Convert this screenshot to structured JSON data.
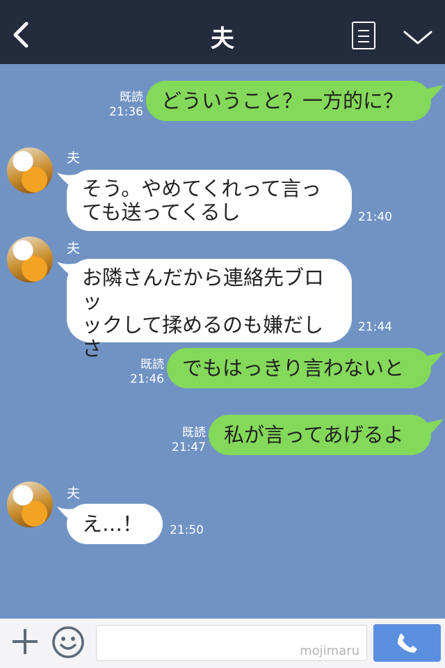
{
  "header": {
    "title": "夫"
  },
  "messages": [
    {
      "side": "right",
      "text": "どういうこと？一方的に？",
      "read": "既読",
      "time": "21:36"
    },
    {
      "side": "left",
      "sender": "夫",
      "lines": [
        "そう。やめてくれって言っ",
        "ても送ってくるし"
      ],
      "time": "21:40"
    },
    {
      "side": "left",
      "sender": "夫",
      "lines": [
        "お隣さんだから連絡先ブロッ",
        "ックして揉めるのも嫌だし",
        "さ"
      ],
      "time": "21:44"
    },
    {
      "side": "right",
      "text": "でもはっきり言わないと",
      "read": "既読",
      "time": "21:46"
    },
    {
      "side": "right",
      "text": "私が言ってあげるよ",
      "read": "既読",
      "time": "21:47"
    },
    {
      "side": "left",
      "sender": "夫",
      "text": "え…！",
      "time": "21:50"
    }
  ],
  "input": {
    "placeholder": "",
    "watermark": "mojimaru"
  },
  "icons": {
    "back": "chevron-left-icon",
    "menu": "menu-list-icon",
    "collapse": "chevron-down-icon",
    "add": "plus-icon",
    "emoji": "smiley-icon",
    "call": "phone-icon"
  },
  "colors": {
    "header_bg": "#232b3d",
    "chat_bg": "#7093c4",
    "bubble_mine": "#84d85a",
    "bubble_theirs": "#ffffff",
    "call_button": "#5b8fe0"
  }
}
